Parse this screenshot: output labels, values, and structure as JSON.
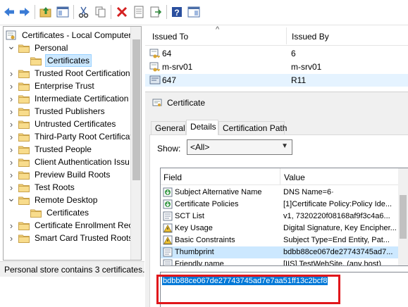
{
  "toolbar": {
    "buttons": [
      {
        "name": "back-button",
        "icon": "arrow-left-icon"
      },
      {
        "name": "forward-button",
        "icon": "arrow-right-icon"
      },
      {
        "name": "up-one-level-button",
        "icon": "folder-up-icon"
      },
      {
        "name": "show-hide-tree-button",
        "icon": "console-tree-icon"
      },
      {
        "name": "cut-button",
        "icon": "scissors-icon"
      },
      {
        "name": "copy-button",
        "icon": "copy-icon"
      },
      {
        "name": "delete-button",
        "icon": "delete-x-icon"
      },
      {
        "name": "properties-button",
        "icon": "properties-icon"
      },
      {
        "name": "export-list-button",
        "icon": "export-icon"
      },
      {
        "name": "help-button",
        "icon": "help-icon"
      },
      {
        "name": "show-hide-action-pane-button",
        "icon": "action-pane-icon"
      }
    ]
  },
  "tree": {
    "root": "Certificates - Local Computer",
    "items": [
      {
        "label": "Personal",
        "expanded": true,
        "level": 1
      },
      {
        "label": "Certificates",
        "level": 2,
        "selected": true
      },
      {
        "label": "Trusted Root Certification",
        "level": 1
      },
      {
        "label": "Enterprise Trust",
        "level": 1
      },
      {
        "label": "Intermediate Certification",
        "level": 1
      },
      {
        "label": "Trusted Publishers",
        "level": 1
      },
      {
        "label": "Untrusted Certificates",
        "level": 1
      },
      {
        "label": "Third-Party Root Certificat",
        "level": 1
      },
      {
        "label": "Trusted People",
        "level": 1
      },
      {
        "label": "Client Authentication Issu",
        "level": 1
      },
      {
        "label": "Preview Build Roots",
        "level": 1
      },
      {
        "label": "Test Roots",
        "level": 1
      },
      {
        "label": "Remote Desktop",
        "expanded": true,
        "level": 1
      },
      {
        "label": "Certificates",
        "level": 2
      },
      {
        "label": "Certificate Enrollment Rec",
        "level": 1
      },
      {
        "label": "Smart Card Trusted Roots",
        "level": 1
      }
    ]
  },
  "status": {
    "text": "Personal store contains 3 certificates."
  },
  "list": {
    "columns": [
      "Issued To",
      "Issued By"
    ],
    "rows": [
      {
        "issued_to": "64",
        "issued_by": "6"
      },
      {
        "issued_to": "m-srv01",
        "issued_by": "m-srv01"
      },
      {
        "issued_to": "647",
        "issued_by": "R11"
      }
    ]
  },
  "dialog": {
    "title": "Certificate",
    "tabs": [
      "General",
      "Details",
      "Certification Path"
    ],
    "active_tab": "Details",
    "show_label": "Show:",
    "show_value": "<All>",
    "field_columns": [
      "Field",
      "Value"
    ],
    "fields": [
      {
        "field": "Subject Alternative Name",
        "value": "DNS Name=6·",
        "icon": "cert-field-download-icon"
      },
      {
        "field": "Certificate Policies",
        "value": "[1]Certificate Policy:Policy Ide...",
        "icon": "cert-field-download-icon"
      },
      {
        "field": "SCT List",
        "value": "v1, 7320220f08168af9f3c4a6...",
        "icon": "cert-field-icon"
      },
      {
        "field": "Key Usage",
        "value": "Digital Signature, Key Encipher...",
        "icon": "cert-field-warning-icon"
      },
      {
        "field": "Basic Constraints",
        "value": "Subject Type=End Entity, Pat...",
        "icon": "cert-field-warning-icon"
      },
      {
        "field": "Thumbprint",
        "value": "bdbb88ce067de27743745ad7...",
        "icon": "cert-field-icon",
        "selected": true
      },
      {
        "field": "Friendly name",
        "value": "[IIS] TestWebSite, (any host)",
        "icon": "cert-field-icon"
      }
    ],
    "thumbprint": "bdbb88ce067de27743745ad7e7aa51ff13c2bcf8"
  },
  "colors": {
    "selection": "#cce8ff",
    "highlight": "#0078d7",
    "annotation_red": "#e0161b"
  }
}
